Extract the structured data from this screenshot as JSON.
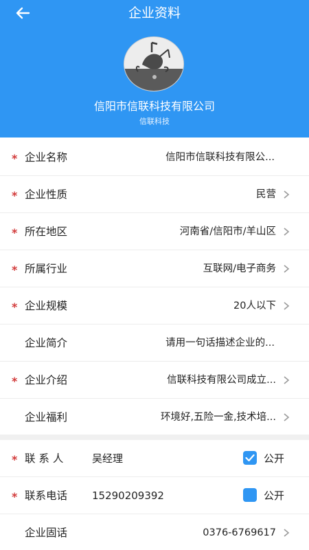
{
  "header": {
    "title": "企业资料",
    "company_name": "信阳市信联科技有限公司",
    "company_short": "信联科技",
    "color": "#2f96f3"
  },
  "icons": {
    "back": "back-arrow-icon",
    "chevron": "chevron-right-icon",
    "check": "checkmark-icon"
  },
  "fields": [
    {
      "label": "企业名称",
      "value": "信阳市信联科技有限公...",
      "required": true,
      "chevron": false
    },
    {
      "label": "企业性质",
      "value": "民营",
      "required": true,
      "chevron": true
    },
    {
      "label": "所在地区",
      "value": "河南省/信阳市/羊山区",
      "required": true,
      "chevron": true
    },
    {
      "label": "所属行业",
      "value": "互联网/电子商务",
      "required": true,
      "chevron": true
    },
    {
      "label": "企业规模",
      "value": "20人以下",
      "required": true,
      "chevron": true
    },
    {
      "label": "企业简介",
      "value": "请用一句话描述企业的...",
      "required": false,
      "chevron": false
    },
    {
      "label": "企业介绍",
      "value": "信联科技有限公司成立...",
      "required": true,
      "chevron": true
    },
    {
      "label": "企业福利",
      "value": "环境好,五险一金,技术培...",
      "required": false,
      "chevron": true
    }
  ],
  "contact": {
    "name_label": "联 系 人",
    "name_value": "吴经理",
    "name_public_checked": true,
    "phone_label": "联系电话",
    "phone_value": "15290209392",
    "phone_public_checked": false,
    "public_label": "公开",
    "landline_label": "企业固话",
    "landline_value": "0376-6769617"
  },
  "required_mark": "*"
}
